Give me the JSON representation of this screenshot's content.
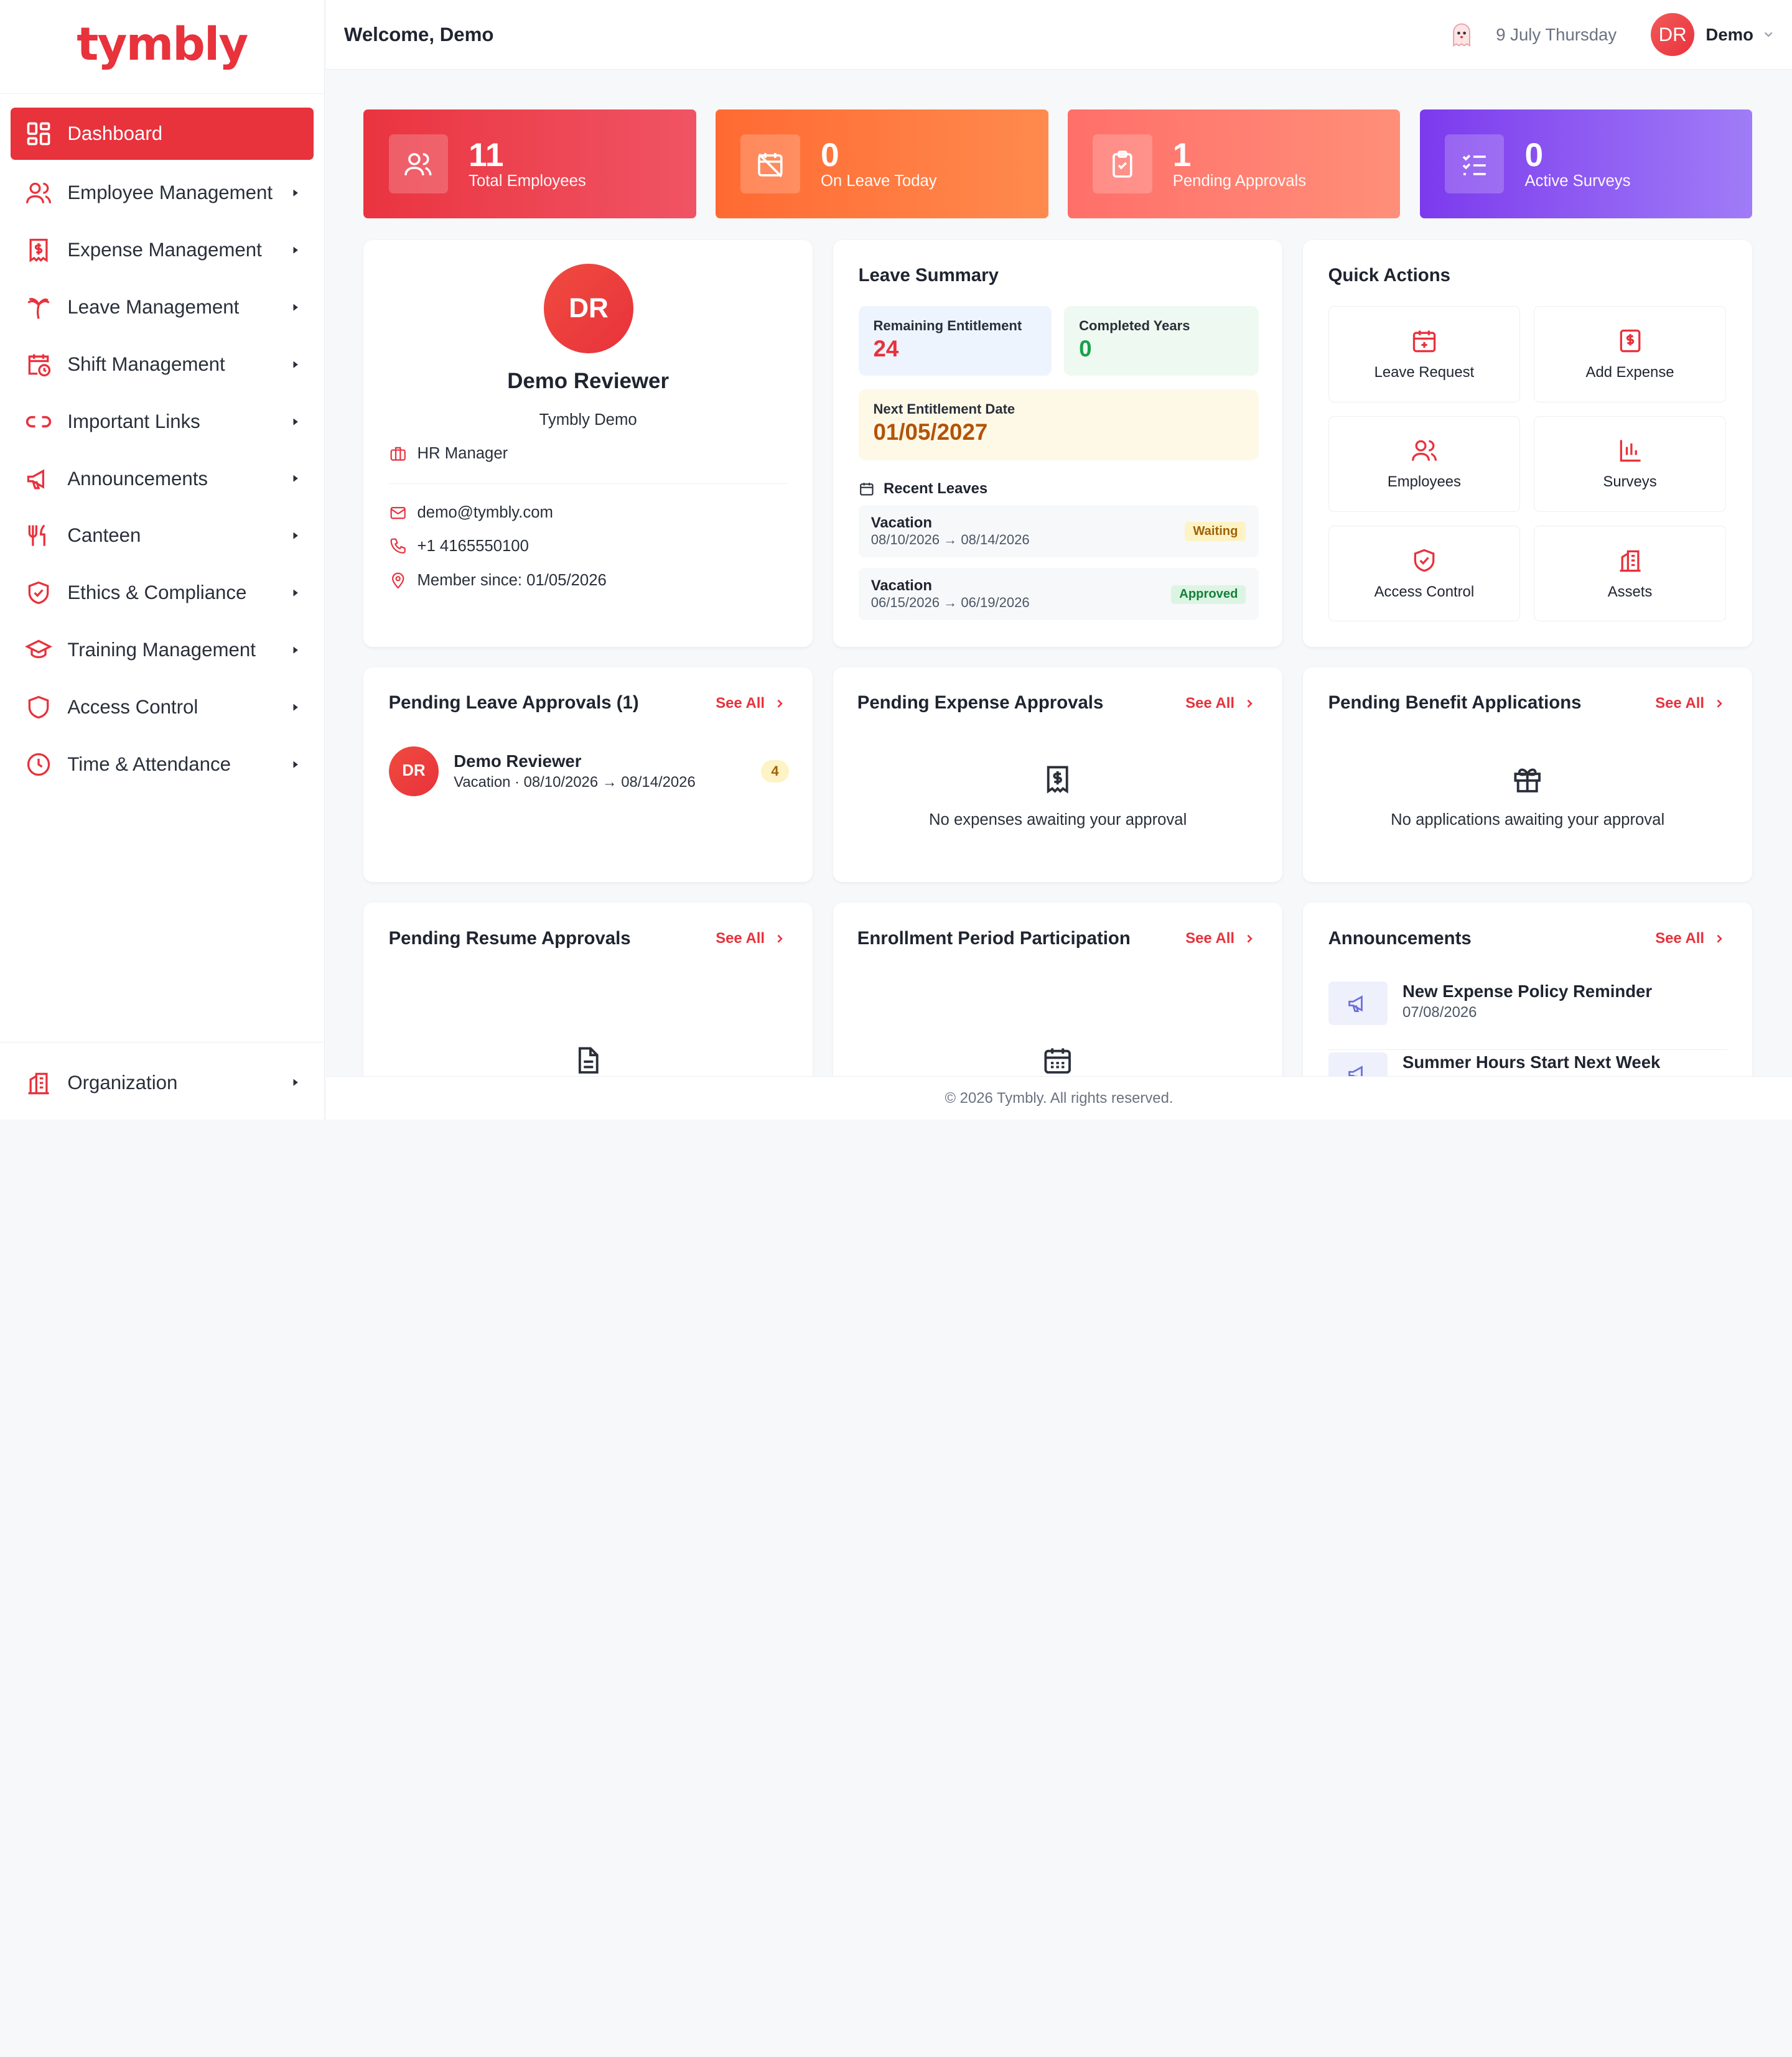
{
  "app": {
    "logo": "tymbly"
  },
  "sidebar": {
    "items": [
      {
        "label": "Dashboard"
      },
      {
        "label": "Employee Management"
      },
      {
        "label": "Expense Management"
      },
      {
        "label": "Leave Management"
      },
      {
        "label": "Shift Management"
      },
      {
        "label": "Important Links"
      },
      {
        "label": "Announcements"
      },
      {
        "label": "Canteen"
      },
      {
        "label": "Ethics & Compliance"
      },
      {
        "label": "Training Management"
      },
      {
        "label": "Access Control"
      },
      {
        "label": "Time & Attendance"
      }
    ],
    "bottom": {
      "label": "Organization"
    }
  },
  "header": {
    "welcome": "Welcome, Demo",
    "date": "9 July Thursday",
    "avatar": "DR",
    "user": "Demo"
  },
  "stats": [
    {
      "value": "11",
      "label": "Total Employees"
    },
    {
      "value": "0",
      "label": "On Leave Today"
    },
    {
      "value": "1",
      "label": "Pending Approvals"
    },
    {
      "value": "0",
      "label": "Active Surveys"
    }
  ],
  "profile": {
    "initials": "DR",
    "name": "Demo Reviewer",
    "company": "Tymbly Demo",
    "role": "HR Manager",
    "email": "demo@tymbly.com",
    "phone": "+1 4165550100",
    "member_since": "Member since: 01/05/2026"
  },
  "leave_summary": {
    "title": "Leave Summary",
    "remaining_label": "Remaining Entitlement",
    "remaining_value": "24",
    "years_label": "Completed Years",
    "years_value": "0",
    "next_label": "Next Entitlement Date",
    "next_value": "01/05/2027",
    "recent_title": "Recent Leaves",
    "recent": [
      {
        "type": "Vacation",
        "dates": "08/10/2026 → 08/14/2026",
        "status": "Waiting"
      },
      {
        "type": "Vacation",
        "dates": "06/15/2026 → 06/19/2026",
        "status": "Approved"
      }
    ]
  },
  "quick_actions": {
    "title": "Quick Actions",
    "items": [
      {
        "label": "Leave Request"
      },
      {
        "label": "Add Expense"
      },
      {
        "label": "Employees"
      },
      {
        "label": "Surveys"
      },
      {
        "label": "Access Control"
      },
      {
        "label": "Assets"
      }
    ]
  },
  "see_all": "See All",
  "pending_leave": {
    "title": "Pending Leave Approvals (1)",
    "initials": "DR",
    "name": "Demo Reviewer",
    "detail": "Vacation · 08/10/2026 → 08/14/2026",
    "days": "4"
  },
  "pending_expense": {
    "title": "Pending Expense Approvals",
    "empty": "No expenses awaiting your approval"
  },
  "pending_benefit": {
    "title": "Pending Benefit Applications",
    "empty": "No applications awaiting your approval"
  },
  "pending_resume": {
    "title": "Pending Resume Approvals"
  },
  "enrollment": {
    "title": "Enrollment Period Participation"
  },
  "announcements": {
    "title": "Announcements",
    "items": [
      {
        "title": "New Expense Policy Reminder",
        "date": "07/08/2026"
      },
      {
        "title": "Summer Hours Start Next Week"
      }
    ]
  },
  "footer": "© 2026 Tymbly. All rights reserved.",
  "colors": {
    "brand": "#e8323c",
    "stat1": "#ef4650",
    "stat2": "#ff7a3d",
    "stat3": "#ff7f6e",
    "stat4": "#8b5cf6",
    "waiting": "#fdf3c4",
    "approved": "#dcf5e3"
  }
}
